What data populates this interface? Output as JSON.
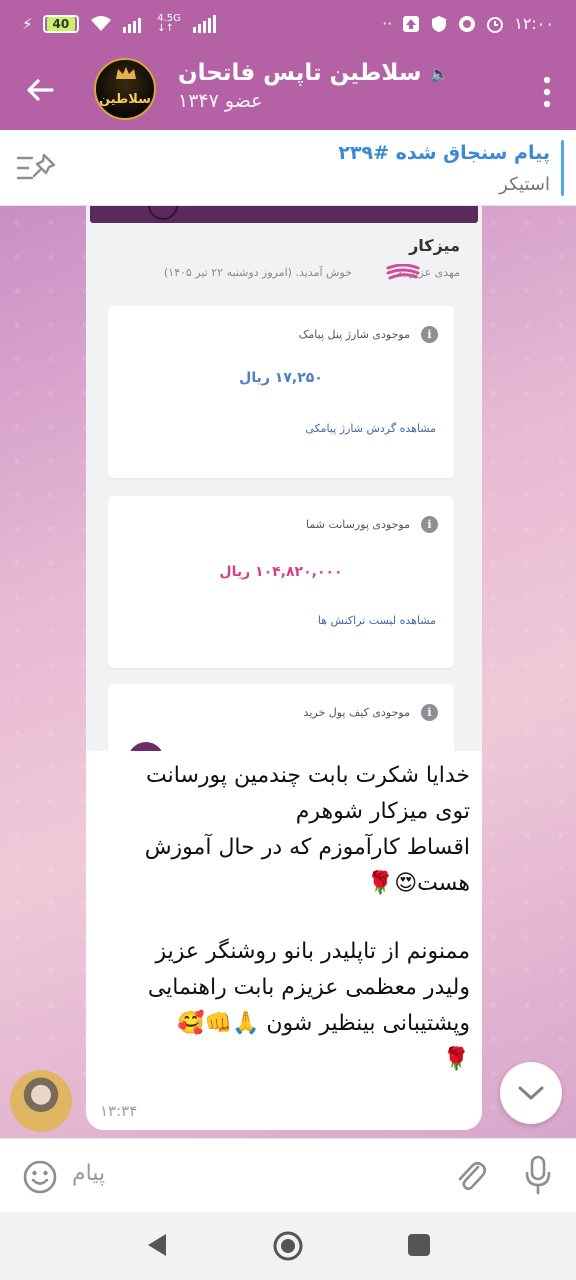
{
  "status_bar": {
    "battery": "40",
    "network": "4.5G",
    "network_sub": "↓↑",
    "time": "۱۲:۰۰",
    "icons": [
      "charging-icon",
      "wifi-icon",
      "signal-icon",
      "upload-icon",
      "shield-icon",
      "vpn-icon",
      "alarm-icon"
    ]
  },
  "header": {
    "title": "سلاطین تاپس فاتحان",
    "members": "۱۳۴۷ عضو",
    "avatar_text": "سلاطین",
    "muted_icon": "🔈"
  },
  "pinned": {
    "title": "پیام سنجاق شده #۲۳۹",
    "subtitle": "استیکر"
  },
  "message": {
    "screenshot": {
      "title": "میزکار",
      "greeting_prefix": "مهدی عزیز به",
      "greeting_suffix": "خوش آمدید. (امروز دوشنبه ۲۲ تیر ۱۴۰۵)",
      "cards": [
        {
          "title": "موجودی شارژ پنل پیامک",
          "amount": "۱۷,۲۵۰ ریال",
          "link": "مشاهده گردش شارژ پیامکی",
          "color": "#4a7fc1"
        },
        {
          "title": "موجودی پورسانت شما",
          "amount": "۱۰۴,۸۲۰,۰۰۰ ریال",
          "link": "مشاهده لیست تراکنش ها",
          "color": "#d63f8c"
        },
        {
          "title": "موجودی کیف پول خرید",
          "amount": "",
          "link": ""
        }
      ]
    },
    "lines": [
      "خدایا شکرت بابت چندمین پورسانت",
      "توی میزکار شوهرم",
      "اقساط کارآموزم که در حال آموزش",
      "هست😍🌹",
      "",
      "ممنونم از تاپلیدر بانو روشنگر عزیز",
      "ولیدر معظمی عزیزم بابت راهنمایی",
      "وپشتیبانی بینظیر شون 🙏👊🥰",
      "🌹"
    ],
    "time": "۱۳:۳۴"
  },
  "input": {
    "placeholder": "پیام"
  },
  "colors": {
    "header": "#b461a5",
    "pinned_accent": "#3a8bd3"
  }
}
